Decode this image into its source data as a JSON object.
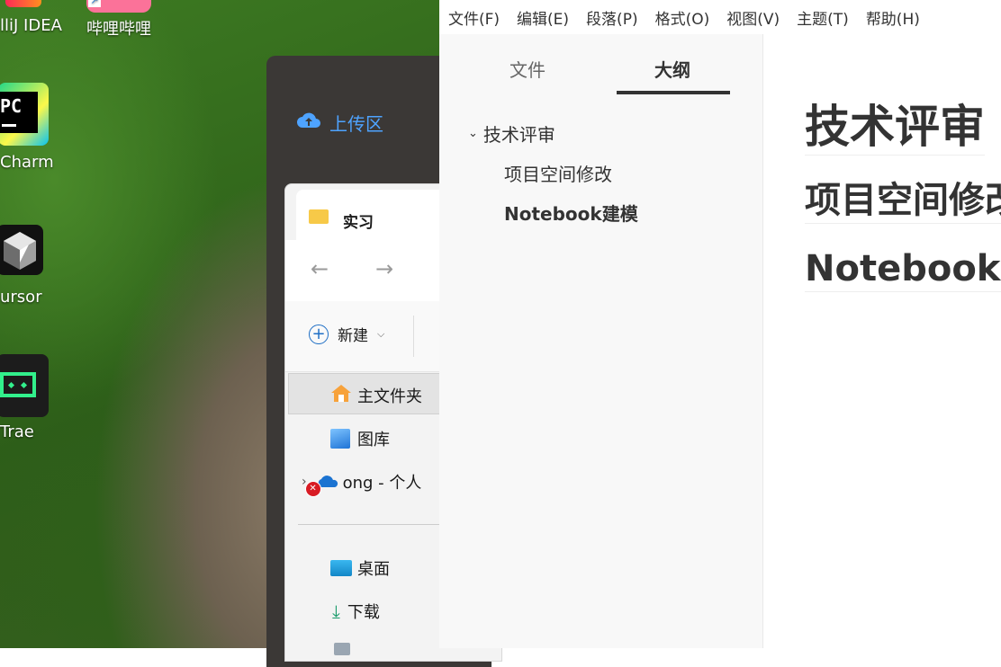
{
  "desktop": {
    "icons": [
      {
        "label": "lliJ IDEA",
        "icon": "intellij-idea-icon"
      },
      {
        "label": "哔哩哔哩",
        "icon": "bilibili-icon"
      },
      {
        "label": "Charm",
        "icon": "pycharm-icon",
        "badge": "PC"
      },
      {
        "label": "Cursor",
        "display": "ursor",
        "icon": "cursor-icon"
      },
      {
        "label": "Trae",
        "icon": "trae-icon"
      }
    ]
  },
  "uploader": {
    "title": "上传区"
  },
  "explorer": {
    "tab_title": "实习",
    "new_label": "新建",
    "nav": [
      {
        "label": "主文件夹",
        "icon": "home-icon",
        "selected": true
      },
      {
        "label": "图库",
        "icon": "gallery-icon"
      },
      {
        "label": "ong - 个人",
        "icon": "onedrive-icon",
        "error": true
      },
      {
        "label": "桌面",
        "icon": "desktop-icon"
      },
      {
        "label": "下载",
        "icon": "download-icon"
      }
    ]
  },
  "typora": {
    "menu": [
      "文件(F)",
      "编辑(E)",
      "段落(P)",
      "格式(O)",
      "视图(V)",
      "主题(T)",
      "帮助(H)"
    ],
    "sidebar_tabs": [
      {
        "label": "文件",
        "active": false
      },
      {
        "label": "大纲",
        "active": true
      }
    ],
    "outline": [
      {
        "label": "技术评审",
        "level": 1,
        "expanded": true
      },
      {
        "label": "项目空间修改",
        "level": 2
      },
      {
        "label": "Notebook建模",
        "level": 2,
        "active": true
      }
    ],
    "headings": [
      "技术评审",
      "项目空间修改",
      "Notebook建模"
    ]
  },
  "colors": {
    "accent": "#4ea3ff",
    "active_tab_underline": "#333333"
  }
}
